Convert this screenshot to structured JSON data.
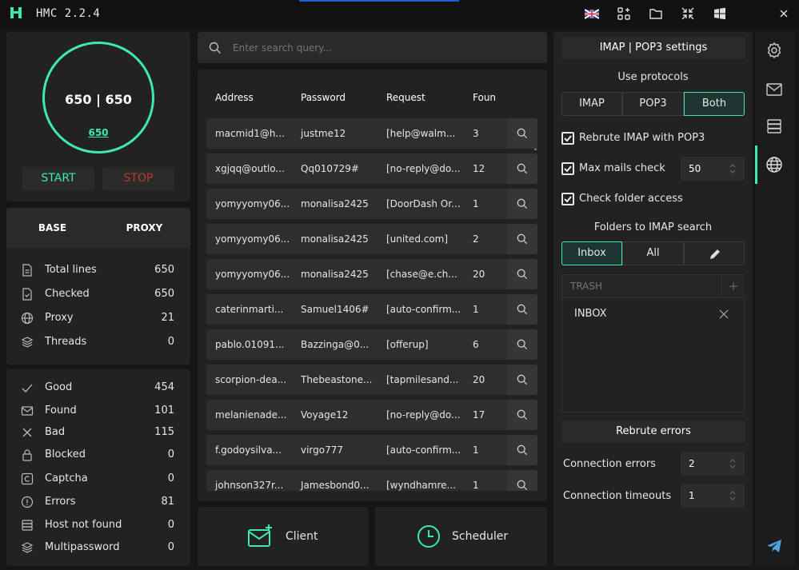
{
  "app": {
    "title": "HMC 2.2.4"
  },
  "gauge": {
    "main": "650 | 650",
    "sub": "650"
  },
  "controls": {
    "start": "START",
    "stop": "STOP"
  },
  "tabs": {
    "base": "BASE",
    "proxy": "PROXY"
  },
  "stats_top": [
    {
      "label": "Total lines",
      "value": "650",
      "icon": "file-lines-icon"
    },
    {
      "label": "Checked",
      "value": "650",
      "icon": "file-check-icon"
    },
    {
      "label": "Proxy",
      "value": "21",
      "icon": "globe-icon"
    },
    {
      "label": "Threads",
      "value": "0",
      "icon": "layers-icon"
    }
  ],
  "stats_bottom": [
    {
      "label": "Good",
      "value": "454",
      "icon": "check-icon"
    },
    {
      "label": "Found",
      "value": "101",
      "icon": "mail-icon"
    },
    {
      "label": "Bad",
      "value": "115",
      "icon": "close-icon"
    },
    {
      "label": "Blocked",
      "value": "0",
      "icon": "lock-icon"
    },
    {
      "label": "Captcha",
      "value": "0",
      "icon": "captcha-icon"
    },
    {
      "label": "Errors",
      "value": "81",
      "icon": "error-icon"
    },
    {
      "label": "Host not found",
      "value": "0",
      "icon": "server-icon"
    },
    {
      "label": "Multipassword",
      "value": "0",
      "icon": "layers-icon"
    }
  ],
  "search": {
    "placeholder": "Enter search query..."
  },
  "table": {
    "headers": [
      "Address",
      "Password",
      "Request",
      "Foun"
    ],
    "rows": [
      [
        "macmid1@h...",
        "justme12",
        "[help@walm...",
        "3"
      ],
      [
        "xgjqq@outlo...",
        "Qq010729#",
        "[no-reply@do...",
        "12"
      ],
      [
        "yomyyomy06...",
        "monalisa2425",
        "[DoorDash Or...",
        "1"
      ],
      [
        "yomyyomy06...",
        "monalisa2425",
        "[united.com]",
        "2"
      ],
      [
        "yomyyomy06...",
        "monalisa2425",
        "[chase@e.ch...",
        "20"
      ],
      [
        "caterinmarti...",
        "Samuel1406#",
        "[auto-confirm...",
        "1"
      ],
      [
        "pablo.01091...",
        "Bazzinga@0...",
        "[offerup]",
        "6"
      ],
      [
        "scorpion-dea...",
        "Thebeastone...",
        "[tapmilesand...",
        "20"
      ],
      [
        "melanienade...",
        "Voyage12",
        "[no-reply@do...",
        "17"
      ],
      [
        "f.godoysilva...",
        "virgo777",
        "[auto-confirm...",
        "1"
      ],
      [
        "johnson327r...",
        "Jamesbond0...",
        "[wyndhamre...",
        "1"
      ]
    ]
  },
  "bottom": {
    "client": "Client",
    "scheduler": "Scheduler"
  },
  "settings": {
    "title": "IMAP | POP3 settings",
    "use_protocols": "Use protocols",
    "protocols": [
      "IMAP",
      "POP3",
      "Both"
    ],
    "protocol_selected": "Both",
    "rebrute_imap": "Rebrute IMAP with POP3",
    "max_mails": "Max mails check",
    "max_mails_value": "50",
    "check_folder": "Check folder access",
    "folders_title": "Folders to IMAP search",
    "folder_tabs": [
      "Inbox",
      "All"
    ],
    "folder_selected": "Inbox",
    "folder_placeholder": "TRASH",
    "folders": [
      "INBOX"
    ],
    "rebrute_errors": "Rebrute errors",
    "conn_errors": "Connection errors",
    "conn_errors_value": "2",
    "conn_timeouts": "Connection timeouts",
    "conn_timeouts_value": "1"
  },
  "colors": {
    "accent": "#3ee8b2",
    "panel": "#222222",
    "background": "#161616"
  }
}
